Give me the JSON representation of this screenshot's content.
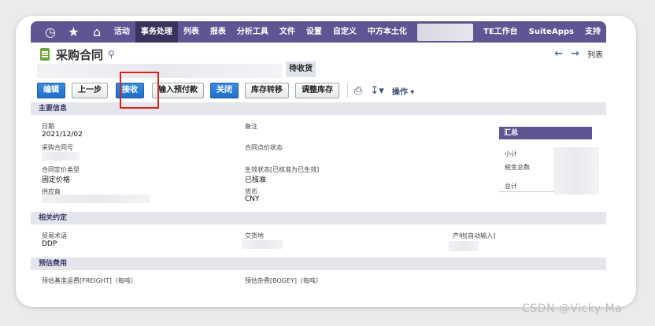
{
  "nav": {
    "items": [
      "活动",
      "事务处理",
      "列表",
      "报表",
      "分析工具",
      "文件",
      "设置",
      "自定义",
      "中方本土化"
    ],
    "right_items": [
      "TE工作台",
      "SuiteApps",
      "支持"
    ],
    "active_item": "事务处理",
    "icons": [
      "history-icon",
      "star-icon",
      "home-icon"
    ]
  },
  "page": {
    "title": "采购合同",
    "status": "待收货",
    "list_link": "列表"
  },
  "toolbar": {
    "edit": "编辑",
    "previous": "上一步",
    "receive": "接收",
    "enter_prepayment": "输入预付款",
    "close": "关闭",
    "inventory_transfer": "库存转移",
    "adjust_inventory": "调整库存",
    "actions": "操作"
  },
  "main_info": {
    "section_title": "主要信息",
    "date_label": "日期",
    "date_value": "2021/12/02",
    "contract_no_label": "采购合同号",
    "pricing_type_label": "合同定价类型",
    "pricing_type_value": "固定价格",
    "supplier_label": "供应商",
    "memo_label": "备注",
    "price_status_label": "合同点价状态",
    "effective_status_label": "生效状态[已核准为已生效]",
    "effective_status_value": "已核准",
    "currency_label": "货币",
    "currency_value": "CNY"
  },
  "summary": {
    "title": "汇总",
    "subtotal_label": "小计",
    "tax_total_label": "税金总数",
    "total_label": "总计"
  },
  "terms": {
    "section_title": "相关约定",
    "trade_term_label": "贸易术语",
    "trade_term_value": "DDP",
    "delivery_place_label": "交货地",
    "origin_label": "产地[自动输入]"
  },
  "estimated_costs": {
    "section_title": "预估费用",
    "freight_label": "预估基准运费[FREIGHT]（每吨）",
    "bogey_label": "预估杂费[BOGEY]（每吨）"
  },
  "colors": {
    "nav_bg": "#5f5592",
    "primary_button": "#2a7bd6",
    "highlight": "#d8241a"
  },
  "watermark": "CSDN @Vicky Ma"
}
